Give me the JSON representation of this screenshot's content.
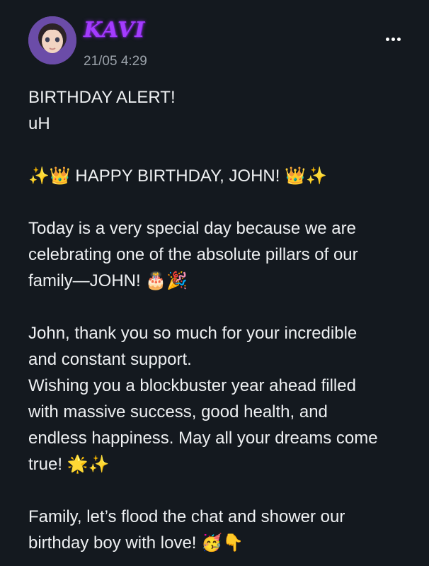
{
  "post": {
    "author": "KAVI",
    "timestamp": "21/05 4:29",
    "menu_icon": "more-options-icon",
    "message_lines": [
      "BIRTHDAY ALERT!",
      "uH",
      "",
      "✨👑 HAPPY BIRTHDAY, JOHN! 👑✨",
      "",
      "Today is a very special day because we are",
      "celebrating one of the absolute pillars of our",
      "family—JOHN! 🎂🎉",
      "",
      "John, thank you so much for your incredible",
      "and constant support.",
      "Wishing you a blockbuster year ahead filled",
      "with massive success, good health, and",
      "endless happiness. May all your dreams come",
      "true! 🌟✨",
      "",
      "Family, let’s flood the chat and shower our",
      "birthday boy with love! 🥳👇"
    ]
  },
  "colors": {
    "background": "#14191f",
    "author_name": "#a43cff",
    "text": "#eef0f2",
    "timestamp": "#9aa1a9"
  }
}
